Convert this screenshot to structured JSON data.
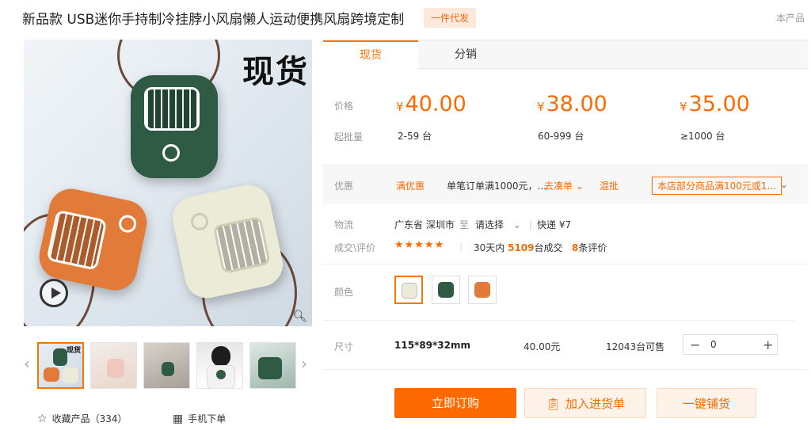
{
  "header": {
    "title": "新品款 USB迷你手持制冷挂脖小风扇懒人运动便携风扇跨境定制",
    "badge": "一件代发",
    "corner_note": "本产品"
  },
  "gallery": {
    "stamp_text": "现货",
    "thumb_stamp": "现货"
  },
  "actions": {
    "favorite_label": "收藏产品（334）",
    "mobile_label": "手机下单"
  },
  "tabs": [
    {
      "label": "现货"
    },
    {
      "label": "分销"
    }
  ],
  "pricing": {
    "price_label": "价格",
    "moq_label": "起批量",
    "currency": "¥",
    "tiers": [
      {
        "price": "40.00",
        "qty": "2-59 台"
      },
      {
        "price": "38.00",
        "qty": "60-999 台"
      },
      {
        "price": "35.00",
        "qty": "≥1000 台"
      }
    ]
  },
  "promo": {
    "label": "优惠",
    "type": "满优惠",
    "detail": "单笔订单满1000元，...",
    "go": "去凑单 ⌄",
    "mix": "混批",
    "coupon": "本店部分商品满100元或1...",
    "more_icon": "⌄"
  },
  "logistics": {
    "label": "物流",
    "from": "广东省 深圳市",
    "to_word": "至",
    "destination": "请选择",
    "shipping": "快递 ¥7"
  },
  "sales": {
    "label": "成交\\评价",
    "stars": "★★★★★",
    "prefix": "30天内",
    "count": "5109",
    "suffix": "台成交",
    "reviews_count": "8",
    "reviews_suffix": "条评价"
  },
  "color": {
    "label": "颜色",
    "options": [
      "white",
      "green",
      "orange"
    ]
  },
  "size": {
    "label": "尺寸",
    "value": "115*89*32mm",
    "price": "40.00元",
    "stock": "12043台可售",
    "qty": "0",
    "minus": "−",
    "plus": "+"
  },
  "buttons": {
    "buy": "立即订购",
    "cart": "加入进货单",
    "distribute": "一键铺货"
  },
  "colors": {
    "accent": "#ff6a00",
    "fan_green": "#2f5a43",
    "fan_orange": "#e27a3a",
    "fan_cream": "#ecebd8"
  }
}
